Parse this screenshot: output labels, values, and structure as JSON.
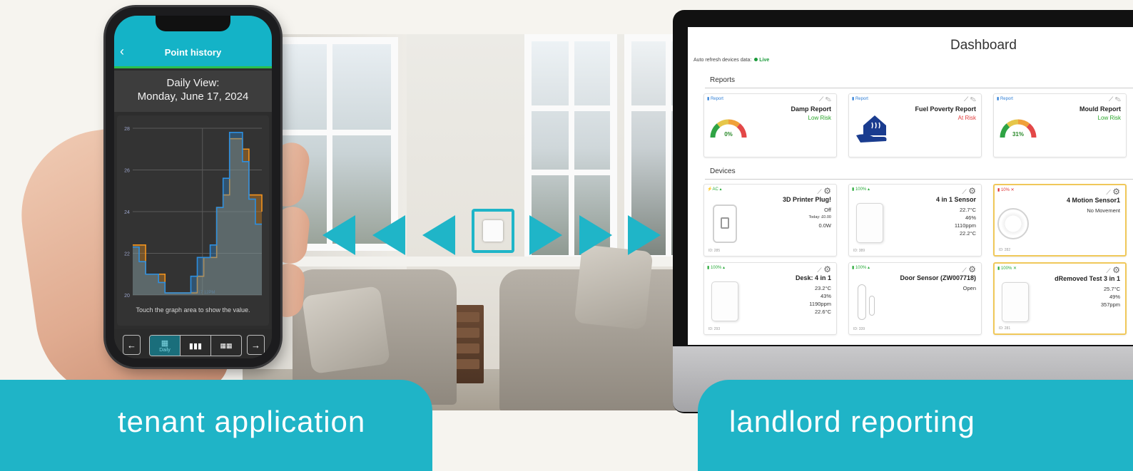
{
  "banners": {
    "tenant": "tenant application",
    "landlord": "landlord reporting"
  },
  "phone_app": {
    "back_label": "‹",
    "header_title": "Point history",
    "view_title": "Daily View:",
    "view_date": "Monday, June 17, 2024",
    "touch_hint": "Touch the graph area to show the value.",
    "x_marker_label": "Jun 17 12PM",
    "nav_prev": "←",
    "nav_next": "→",
    "view_modes": [
      "Daily",
      "Weekly",
      "Monthly"
    ],
    "active_mode": "Daily",
    "colors": {
      "header": "#14b3c7",
      "accent_line": "#2cbf4c",
      "series_blue": "#2d8fe0",
      "series_orange": "#f2931e"
    }
  },
  "chart_data": {
    "type": "area",
    "y_ticks": [
      "28",
      "26",
      "24",
      "22",
      "20"
    ],
    "ylim": [
      20,
      28
    ],
    "x_marker": "Jun 17 12PM",
    "grid": true,
    "series": [
      {
        "values": [
          22.4,
          22.4,
          21.0,
          21.0,
          21.0,
          20.1,
          20.1,
          20.1,
          20.1,
          20.1,
          20.9,
          21.8,
          21.8,
          24.2,
          24.8,
          27.5,
          27.5,
          27.0,
          24.8,
          24.8,
          24.0
        ]
      },
      {
        "values": [
          22.3,
          21.6,
          21.0,
          21.0,
          20.6,
          20.1,
          20.1,
          20.1,
          20.1,
          20.9,
          21.8,
          21.8,
          22.4,
          24.2,
          25.6,
          27.8,
          27.8,
          26.4,
          24.6,
          23.4,
          23.4
        ]
      }
    ]
  },
  "dashboard": {
    "title": "Dashboard",
    "auto_refresh_label": "Auto refresh devices data:",
    "live_label": "Live",
    "sections": {
      "reports": "Reports",
      "devices": "Devices"
    },
    "reports": [
      {
        "tag": "Report",
        "title": "Damp Report",
        "status": "Low Risk",
        "status_color": "#2ba52b",
        "gauge_value": "0%",
        "icon": "gauge-icon"
      },
      {
        "tag": "Report",
        "title": "Fuel Poverty Report",
        "status": "At Risk",
        "status_color": "#e24040",
        "icon": "house-hand-icon"
      },
      {
        "tag": "Report",
        "title": "Mould Report",
        "status": "Low Risk",
        "status_color": "#2ba52b",
        "gauge_value": "31%",
        "icon": "gauge-icon"
      }
    ],
    "devices": [
      {
        "tag": "AC",
        "title": "3D Printer Plug!",
        "lines": [
          "Off",
          "Today: £0.00",
          "0.0W"
        ],
        "id": "ID: 285",
        "kind": "plug"
      },
      {
        "tag": "100%",
        "title": "4 in 1 Sensor",
        "lines": [
          "22.7°C",
          "46%",
          "1110ppm",
          "22.2°C"
        ],
        "id": "ID: 389",
        "kind": "panel"
      },
      {
        "tag": "10%",
        "title": "4 Motion Sensor1",
        "lines": [
          "No Movement"
        ],
        "id": "ID: 282",
        "kind": "round",
        "warn": true
      },
      {
        "tag": "100%",
        "title": "Desk: 4 in 1",
        "lines": [
          "23.2°C",
          "43%",
          "1190ppm",
          "22.6°C"
        ],
        "id": "ID: 293",
        "kind": "panel"
      },
      {
        "tag": "100%",
        "title": "Door Sensor (ZW007718)",
        "lines": [
          "Open"
        ],
        "id": "ID: 339",
        "kind": "door"
      },
      {
        "tag": "100%",
        "title": "dRemoved Test 3 in 1",
        "lines": [
          "25.7°C",
          "49%",
          "357ppm"
        ],
        "id": "ID: 281",
        "kind": "panel",
        "warn": true
      }
    ]
  }
}
